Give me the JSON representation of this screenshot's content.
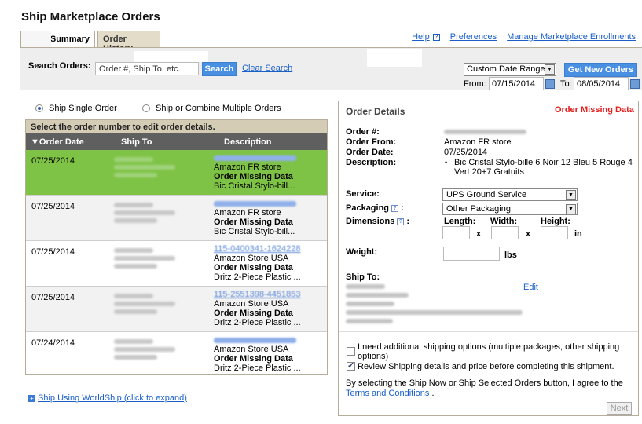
{
  "page": {
    "title": "Ship Marketplace Orders"
  },
  "tabs": [
    {
      "label": "Summary"
    },
    {
      "label": "Order History"
    }
  ],
  "top_links": {
    "help": "Help",
    "preferences": "Preferences",
    "manage": "Manage Marketplace Enrollments"
  },
  "search": {
    "label": "Search Orders:",
    "value": "Order #, Ship To, etc.",
    "button": "Search",
    "clear": "Clear Search"
  },
  "date_filter": {
    "selected": "Custom Date Range",
    "get_orders": "Get New Orders",
    "from_label": "From:",
    "from_value": "07/15/2014",
    "to_label": "To:",
    "to_value": "08/05/2014"
  },
  "ship_mode": {
    "single": "Ship Single Order",
    "multiple": "Ship or Combine Multiple Orders",
    "selected": "single"
  },
  "orders": {
    "caption": "Select the order number to edit order details.",
    "columns": [
      "▼Order Date",
      "Ship To",
      "Description"
    ],
    "rows": [
      {
        "date": "07/25/2014",
        "store": "Amazon FR store",
        "status": "Order Missing Data",
        "item": "Bic Cristal Stylo-bill..."
      },
      {
        "date": "07/25/2014",
        "store": "Amazon FR store",
        "status": "Order Missing Data",
        "item": "Bic Cristal Stylo-bill..."
      },
      {
        "date": "07/25/2014",
        "order_no": "115-0400341-1624228",
        "store": "Amazon Store USA",
        "status": "Order Missing Data",
        "item": "Dritz 2-Piece Plastic ..."
      },
      {
        "date": "07/25/2014",
        "order_no": "115-2551398-4451853",
        "store": "Amazon Store USA",
        "status": "Order Missing Data",
        "item": "Dritz 2-Piece Plastic ..."
      },
      {
        "date": "07/24/2014",
        "store": "Amazon Store USA",
        "status": "Order Missing Data",
        "item": "Dritz 2-Piece Plastic ..."
      }
    ]
  },
  "worldship": "Ship Using WorldShip (click to expand)",
  "details": {
    "title": "Order Details",
    "status": "Order Missing Data",
    "order_no_label": "Order #:",
    "from_label": "Order From:",
    "from_value": "Amazon FR store",
    "date_label": "Order Date:",
    "date_value": "07/25/2014",
    "desc_label": "Description:",
    "desc_value": "Bic Cristal Stylo-bille 6 Noir 12 Bleu 5 Rouge 4 Vert 20+7 Gratuits",
    "service_label": "Service:",
    "service_value": "UPS Ground Service",
    "packaging_label": "Packaging",
    "packaging_value": "Other Packaging",
    "dimensions_label": "Dimensions",
    "length_label": "Length:",
    "width_label": "Width:",
    "height_label": "Height:",
    "x": "x",
    "in": "in",
    "weight_label": "Weight:",
    "lbs": "lbs",
    "shipto_label": "Ship To:",
    "edit": "Edit",
    "option1": "I need additional shipping options (multiple packages, other shipping options)",
    "option2": "Review Shipping details and price before completing this shipment.",
    "terms_text": "By selecting the Ship Now or Ship Selected Orders button, I agree to the",
    "terms_link": "Terms and Conditions",
    "terms_end": ".",
    "next": "Next"
  }
}
